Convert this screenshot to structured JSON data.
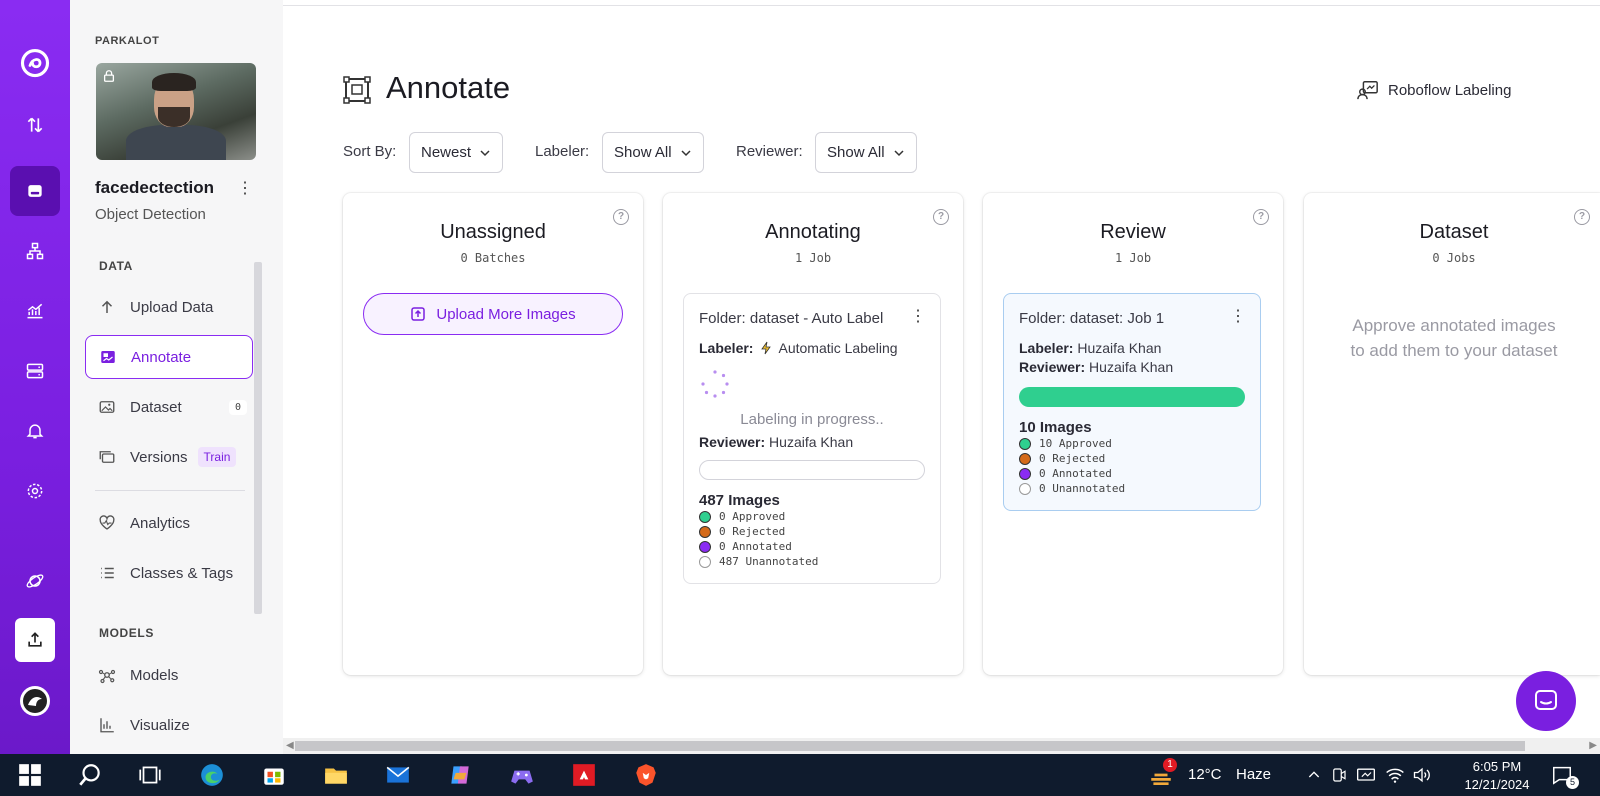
{
  "workspace": {
    "name": "PARKALOT"
  },
  "project": {
    "name": "facedectection",
    "type": "Object Detection"
  },
  "sidebar": {
    "data_section": "DATA",
    "items": [
      {
        "label": "Upload Data",
        "icon": "arrow-up-icon"
      },
      {
        "label": "Annotate",
        "icon": "annotate-icon",
        "active": true
      },
      {
        "label": "Dataset",
        "icon": "image-icon",
        "badge": "0"
      },
      {
        "label": "Versions",
        "icon": "versions-icon",
        "badge": "Train"
      },
      {
        "label": "Analytics",
        "icon": "heart-pulse-icon"
      },
      {
        "label": "Classes & Tags",
        "icon": "list-icon"
      }
    ],
    "models_section": "MODELS",
    "model_items": [
      {
        "label": "Models",
        "icon": "graph-icon"
      },
      {
        "label": "Visualize",
        "icon": "bar-chart-icon"
      }
    ]
  },
  "header": {
    "title": "Annotate",
    "roboflow_labeling": "Roboflow Labeling"
  },
  "filters": {
    "sort_label": "Sort By:",
    "sort_value": "Newest",
    "labeler_label": "Labeler:",
    "labeler_value": "Show All",
    "reviewer_label": "Reviewer:",
    "reviewer_value": "Show All"
  },
  "columns": {
    "unassigned": {
      "title": "Unassigned",
      "subtitle": "0 Batches",
      "button": "Upload More Images"
    },
    "annotating": {
      "title": "Annotating",
      "subtitle": "1 Job",
      "job": {
        "title": "Folder: dataset - Auto Label",
        "labeler_key": "Labeler:",
        "labeler_value": "Automatic Labeling",
        "progress_text": "Labeling in progress..",
        "reviewer_key": "Reviewer:",
        "reviewer_value": "Huzaifa Khan",
        "progress": 0,
        "images": "487 Images",
        "stats": [
          "0 Approved",
          "0 Rejected",
          "0 Annotated",
          "487 Unannotated"
        ]
      }
    },
    "review": {
      "title": "Review",
      "subtitle": "1 Job",
      "job": {
        "title": "Folder: dataset: Job 1",
        "labeler_key": "Labeler:",
        "labeler_value": "Huzaifa Khan",
        "reviewer_key": "Reviewer:",
        "reviewer_value": "Huzaifa Khan",
        "progress": 1,
        "images": "10 Images",
        "stats": [
          "10 Approved",
          "0 Rejected",
          "0 Annotated",
          "0 Unannotated"
        ]
      }
    },
    "dataset": {
      "title": "Dataset",
      "subtitle": "0 Jobs",
      "message": "Approve annotated images to add them to your dataset"
    }
  },
  "colors": {
    "brand": "#7a1fe0",
    "approved": "#2fcf8f",
    "rejected": "#d46a1a",
    "annotated": "#8a2cf2",
    "unannotated": "#ffffff"
  },
  "taskbar": {
    "weather": "12°C",
    "weather_desc": "Haze",
    "time": "6:05 PM",
    "date": "12/21/2024",
    "weather_badge": "1",
    "notification_count": "5"
  }
}
